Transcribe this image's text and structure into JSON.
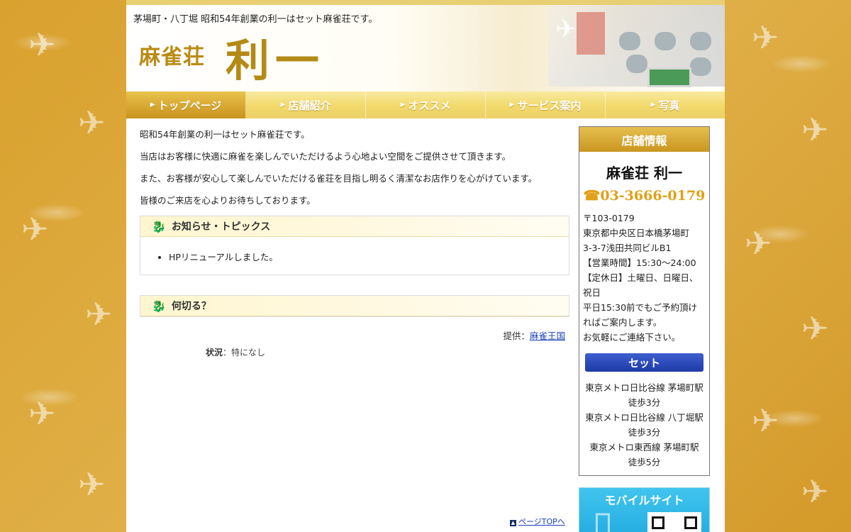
{
  "header": {
    "tagline": "茅場町・八丁堀 昭和54年創業の利一はセット麻雀荘です。",
    "logo_small": "麻雀荘",
    "logo_big": "利一"
  },
  "nav": {
    "items": [
      {
        "label": "トップページ"
      },
      {
        "label": "店舗紹介"
      },
      {
        "label": "オススメ"
      },
      {
        "label": "サービス案内"
      },
      {
        "label": "写真"
      }
    ]
  },
  "intro": {
    "p1": "昭和54年創業の利一はセット麻雀荘です。",
    "p2": "当店はお客様に快適に麻雀を楽しんでいただけるよう心地よい空間をご提供させて頂きます。",
    "p3": "また、お客様が安心して楽しんでいただける雀荘を目指し明るく清潔なお店作りを心がけています。",
    "p4": "皆様のご来店を心よりお待ちしております。"
  },
  "news": {
    "title": "お知らせ・トピックス",
    "items": [
      "HPリニューアルしました。"
    ]
  },
  "nanikiru": {
    "title": "何切る？",
    "provided_prefix": "提供：",
    "provided_link": "麻雀王国",
    "status_label": "状況",
    "status_value": "：特になし"
  },
  "pagetop": "ページTOPへ",
  "sidebar": {
    "title": "店舗情報",
    "shop_name": "麻雀荘 利一",
    "tel": "03-3666-0179",
    "addr": [
      "〒103-0179",
      "東京都中央区日本橋茅場町",
      "3-3-7浅田共同ビルB1",
      "【営業時間】15:30〜24:00",
      "【定休日】土曜日、日曜日、",
      "祝日",
      "平日15:30前でもご予約頂け",
      "ればご案内します。",
      "お気軽にご連絡下さい。"
    ],
    "set_button": "セット",
    "access": [
      "東京メトロ日比谷線 茅場町駅",
      "徒歩3分",
      "東京メトロ日比谷線 八丁堀駅",
      "徒歩3分",
      "東京メトロ東西線 茅場町駅",
      "徒歩5分"
    ],
    "mobile_title": "モバイルサイト"
  }
}
